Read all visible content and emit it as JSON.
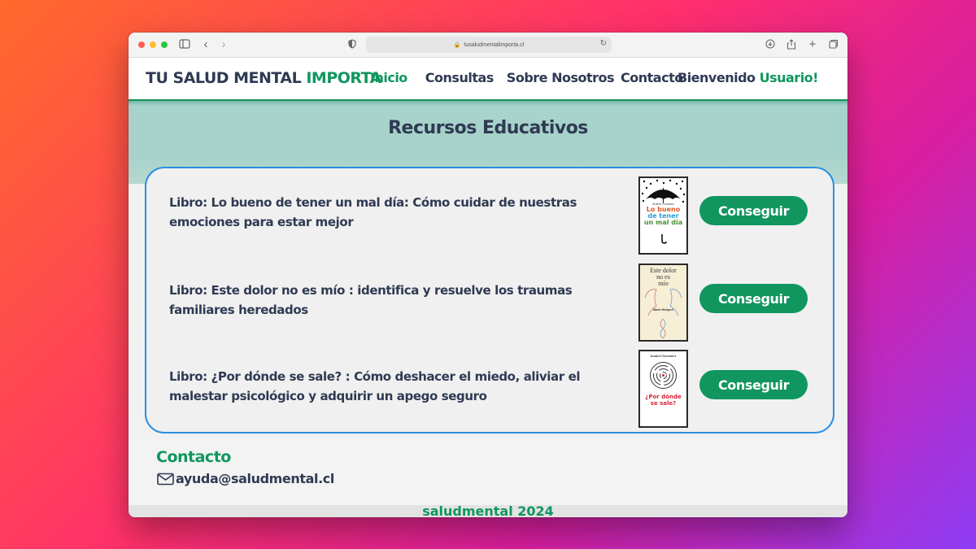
{
  "browser": {
    "url": "tusaludmentalimporta.cl",
    "icons": [
      "sidebar-toggle-icon",
      "back-icon",
      "forward-icon",
      "shield-icon",
      "lock-icon",
      "reload-icon",
      "download-icon",
      "share-icon",
      "new-tab-icon",
      "tabs-overview-icon"
    ]
  },
  "header": {
    "brand_main": "TU SALUD MENTAL ",
    "brand_accent": "IMPORTA",
    "nav": [
      {
        "label": "Inicio",
        "active": true
      },
      {
        "label": "Consultas"
      },
      {
        "label": "Sobre Nosotros"
      },
      {
        "label": "Contacto"
      }
    ],
    "welcome_prefix": "Bienvenido ",
    "welcome_user": "Usuario!"
  },
  "main": {
    "section_title": "Recursos Educativos",
    "books": [
      {
        "title": "Libro: Lo bueno de tener un mal día: Cómo cuidar de nuestras emociones para estar mejor",
        "button": "Conseguir",
        "cover": {
          "author": "Anabel Gonzalez",
          "line1": "Lo bueno",
          "line2": "de tener",
          "line3": "un mal día"
        }
      },
      {
        "title": "Libro: Este dolor no es mío : identifica y resuelve los traumas familiares heredados",
        "button": "Conseguir",
        "cover": {
          "line1": "Este dolor",
          "line2": "no es",
          "line3": "mío",
          "author": "Mark Wolynn"
        }
      },
      {
        "title": "Libro: ¿Por dónde se sale? : Cómo deshacer el miedo, aliviar el malestar psicológico y adquirir un apego seguro",
        "button": "Conseguir",
        "cover": {
          "author": "Anabel Gonzalez",
          "line1": "¿Por dónde",
          "line2": "se sale?"
        }
      }
    ]
  },
  "footer": {
    "contact_title": "Contacto",
    "email": "ayuda@saludmental.cl",
    "copyright": "saludmental 2024"
  },
  "colors": {
    "brand_green": "#11965f",
    "navy": "#2f3a53",
    "panel_border": "#2b8fe0",
    "hero": "#a8d3cb"
  }
}
